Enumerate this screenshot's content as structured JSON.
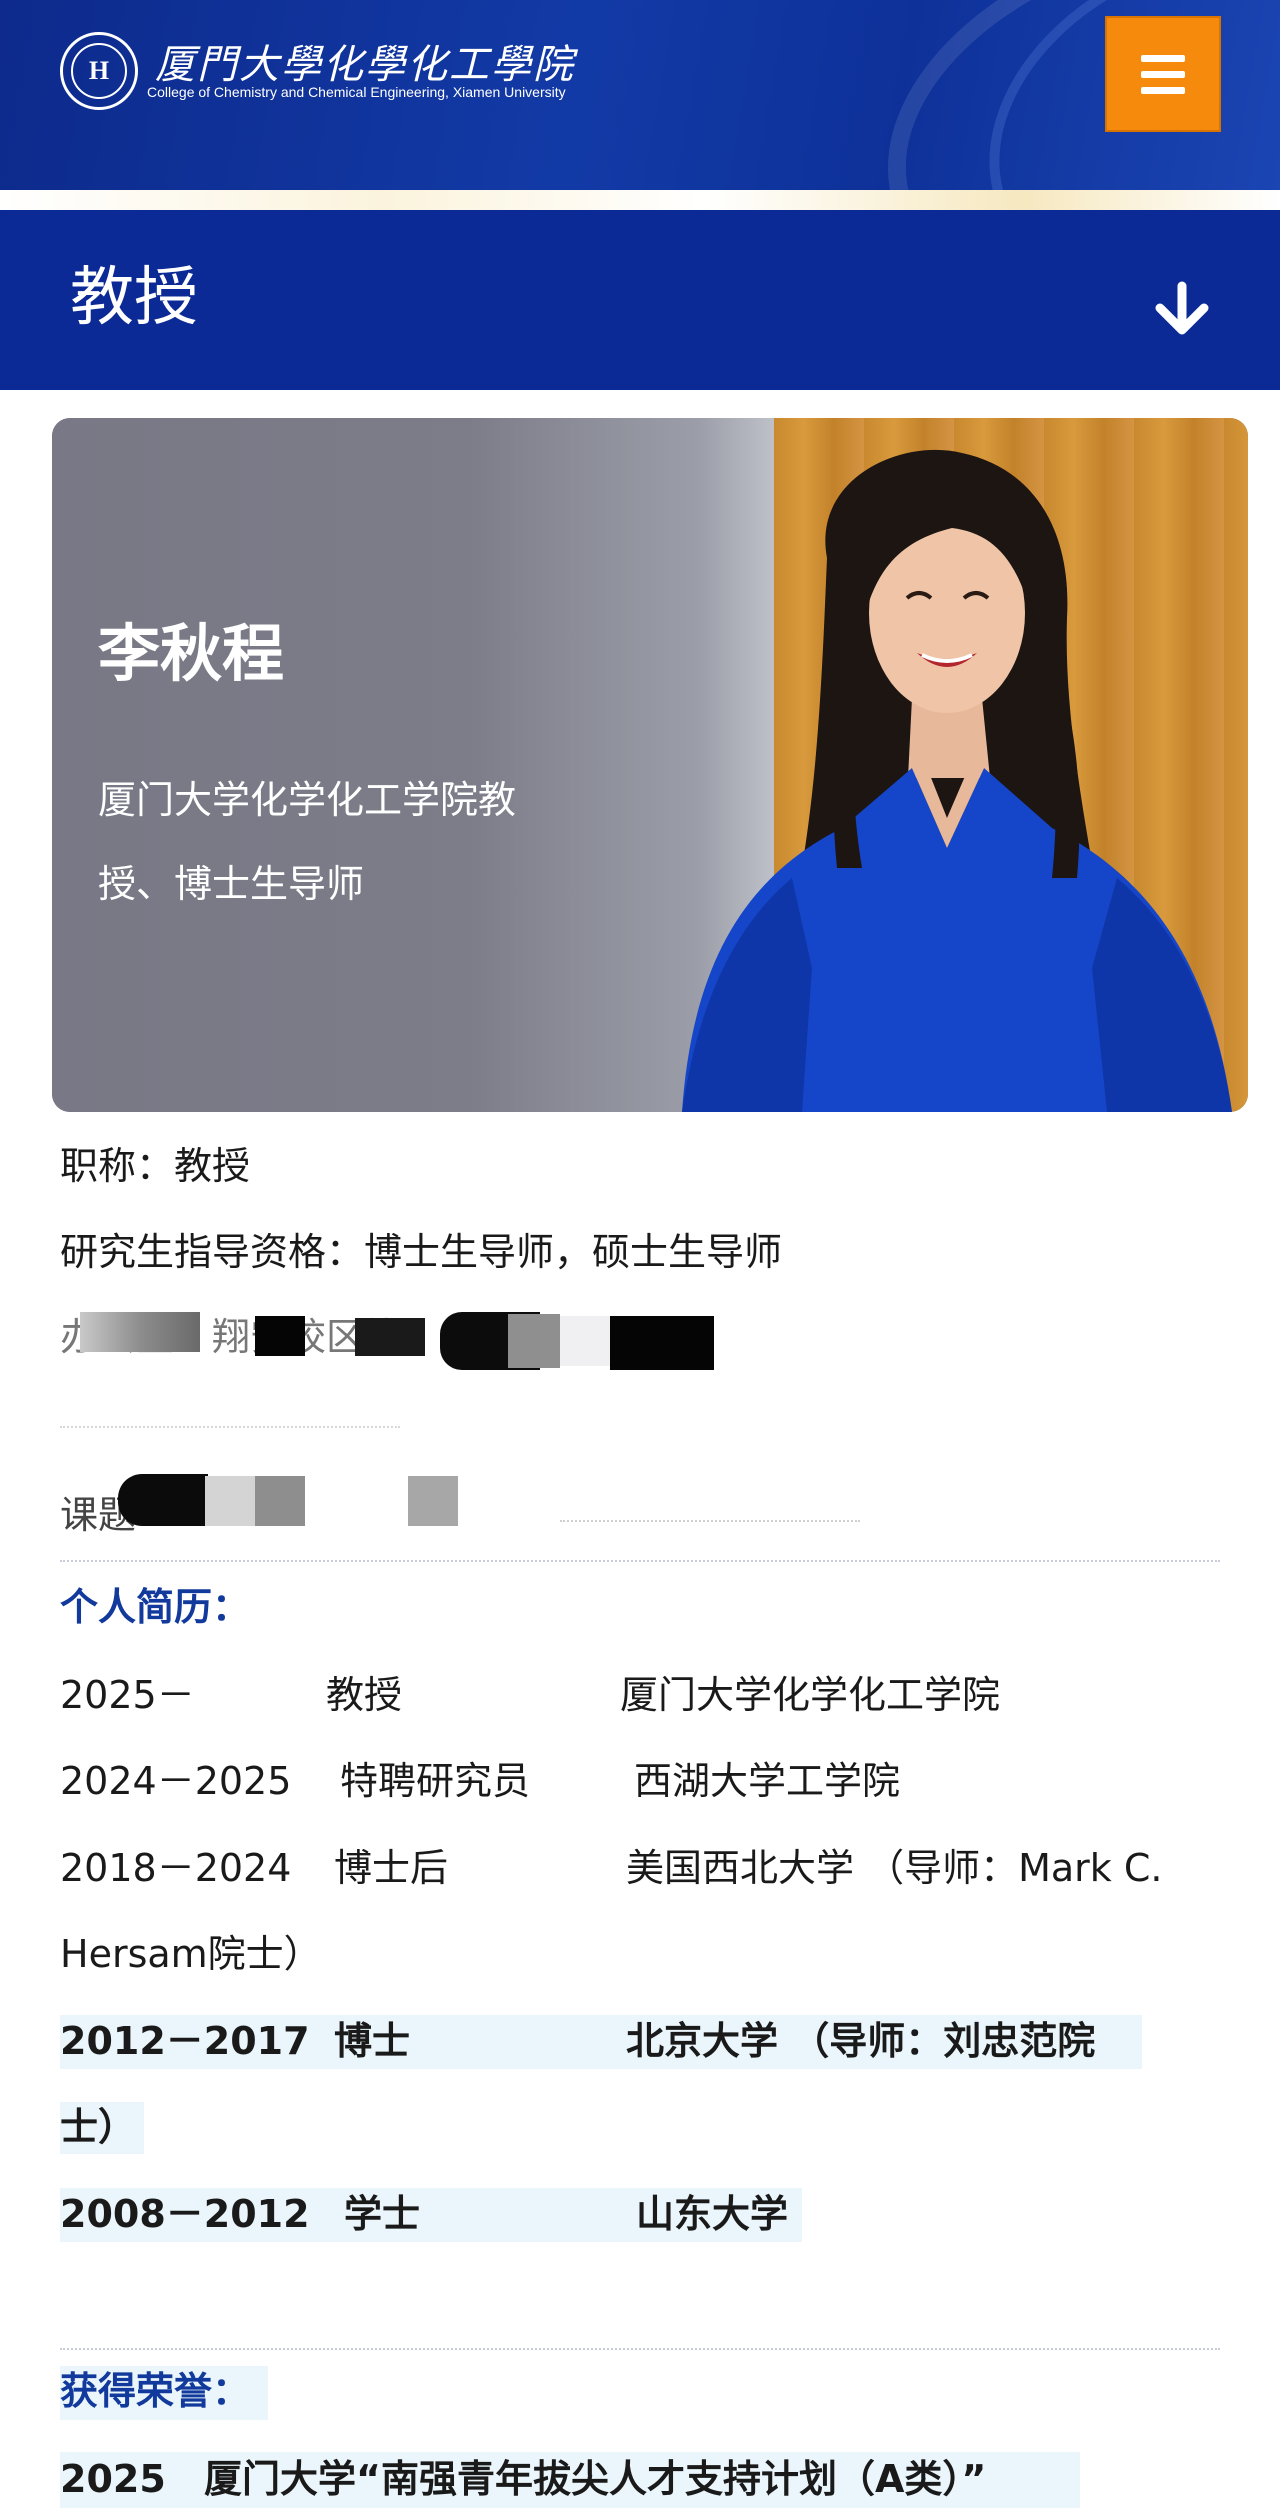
{
  "header": {
    "college_cn": "厦門大學化學化工學院",
    "college_en": "College of Chemistry and Chemical Engineering, Xiamen University",
    "menu_icon": "hamburger-menu-icon",
    "brand_color": "#0b2a96",
    "menu_color": "#f58a0c"
  },
  "category": {
    "title": "教授",
    "arrow_icon": "arrow-down-icon"
  },
  "profile": {
    "name": "李秋程",
    "role": "厦门大学化学化工学院教授、博士生导师"
  },
  "info": {
    "title_line": "职称：教授",
    "advisor_line": "研究生指导资格：博士生导师，硕士生导师",
    "office_prefix": "办公室：翔安校区能",
    "topic_prefix": "课题"
  },
  "resume": {
    "heading": "个人简历：",
    "rows": [
      {
        "years": "2025－",
        "position": "教授",
        "org": "厦门大学化学化工学院"
      },
      {
        "years": "2024－2025",
        "position": "特聘研究员",
        "org": "西湖大学工学院"
      },
      {
        "years": "2018－2024",
        "position": "博士后",
        "org": "美国西北大学 （导师：Mark C.",
        "org_cont": "Hersam院士）"
      },
      {
        "years": "2012－2017",
        "position": "博士",
        "org": "北京大学 （导师：刘忠范院",
        "org_cont": "士）"
      },
      {
        "years": "2008－2012",
        "position": "学士",
        "org": "山东大学"
      }
    ]
  },
  "honors": {
    "heading": "获得荣誉：",
    "rows": [
      {
        "year": "2025",
        "text": "厦门大学“南强青年拔尖人才支持计划（A类）”"
      }
    ]
  }
}
